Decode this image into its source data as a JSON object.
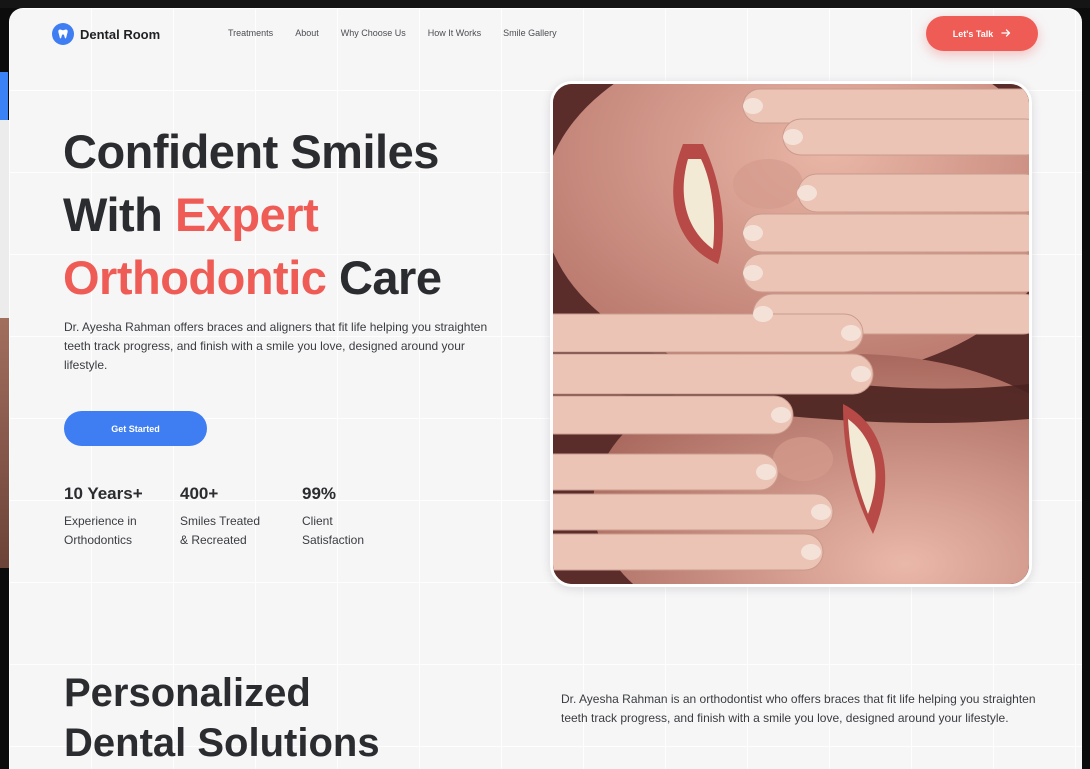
{
  "brand": {
    "name": "Dental Room"
  },
  "nav": {
    "links": [
      "Treatments",
      "About",
      "Why Choose Us",
      "How It Works",
      "Smile Gallery"
    ],
    "cta_label": "Let's Talk"
  },
  "hero": {
    "title_line1": "Confident Smiles",
    "title_line2_plain": "With ",
    "title_line2_accent": "Expert",
    "title_line3_accent": "Orthodontic",
    "title_line3_plain": " Care",
    "description": "Dr. Ayesha Rahman offers braces and aligners that fit life helping you straighten teeth track progress, and finish with a smile you love, designed around your lifestyle.",
    "cta_label": "Get Started",
    "stats": [
      {
        "value": "10 Years+",
        "label_line1": "Experience in",
        "label_line2": "Orthodontics"
      },
      {
        "value": "400+",
        "label_line1": "Smiles Treated",
        "label_line2": "& Recreated"
      },
      {
        "value": "99%",
        "label_line1": "Client",
        "label_line2": "Satisfaction"
      }
    ]
  },
  "section2": {
    "title_line1": "Personalized",
    "title_line2": "Dental Solutions",
    "description": "Dr. Ayesha Rahman is an orthodontist who offers braces that fit life helping you straighten teeth track progress, and finish with a smile you love, designed around your lifestyle."
  },
  "colors": {
    "accent": "#ef5c55",
    "primary": "#3f7df3",
    "text": "#2b2c2f",
    "background": "#f6f6f7"
  },
  "icons": {
    "logo": "tooth-icon",
    "arrow": "arrow-right-icon"
  }
}
